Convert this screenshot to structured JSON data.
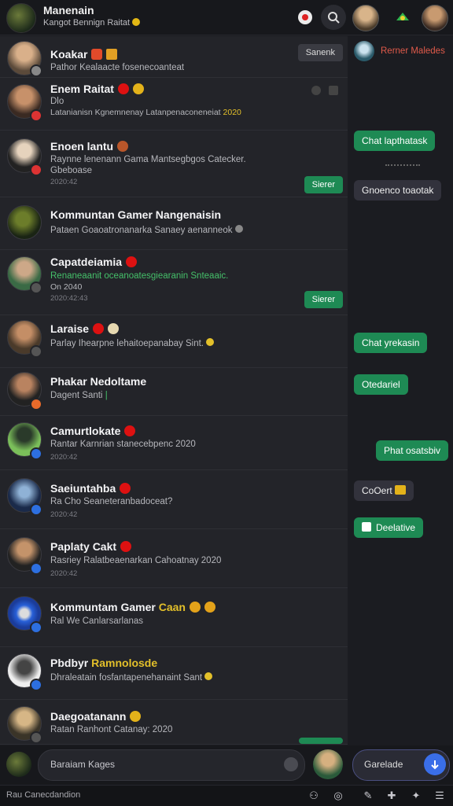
{
  "header": {
    "title": "Manenain",
    "subtitle": "Kangot Bennign Raitat",
    "icons": [
      "notification-icon",
      "search-icon",
      "profile-avatar",
      "game-icon",
      "user-avatar"
    ]
  },
  "chats": [
    {
      "name": "Koakar",
      "message": "Pathor Kealaacte fosenecoanteat",
      "meta": "",
      "action": "Sanenk"
    },
    {
      "name": "Enem Raitat",
      "message": "Dlo",
      "message2": "Latanianisn Kgnemnenay Latanpenaconeneiat",
      "meta": "2020",
      "action": ""
    },
    {
      "name": "Enoen lantu",
      "message": "Raynne lenenann Gama Mantsegbgos Catecker.",
      "message2": "Gbeboase",
      "meta": "2020:42",
      "action": "Sierer"
    },
    {
      "name": "Kommuntan Gamer Nangenaisin",
      "message": "Pataen Goaoatronanarka Sanaey aenanneok",
      "meta": "",
      "action": ""
    },
    {
      "name": "Capatdeiamia",
      "message": "Renaneaanit oceanoatesgiearanin Snteaaic.",
      "message2": "On 2040",
      "meta": "2020:42:43",
      "action": "Sierer"
    },
    {
      "name": "Laraise",
      "message": "Parlay Ihearpne lehaitoepanabay Sint.",
      "meta": "",
      "action": ""
    },
    {
      "name": "Phakar Nedoltame",
      "message": "Dagent Santi",
      "meta": "",
      "action": ""
    },
    {
      "name": "Camurtlokate",
      "message": "Rantar Karnrian stanecebpenc 2020",
      "meta": "2020:42",
      "action": ""
    },
    {
      "name": "Saeiuntahba",
      "message": "Ra Cho Seaneteranbadoceat?",
      "meta": "2020:42",
      "action": ""
    },
    {
      "name": "Paplaty Cakt",
      "message": "Rasriey Ralatbeaenarkan Cahoatnay 2020",
      "meta": "2020:42",
      "action": ""
    },
    {
      "name": "Kommuntam Gamer",
      "name_accent": "Caan",
      "message": "Ral We Canlarsarlanas",
      "meta": "",
      "action": ""
    },
    {
      "name": "Pbdbyr",
      "name_accent": "Ramnolosde",
      "message": "Dhraleatain fosfantapenehanaint Sant",
      "meta": "",
      "action": ""
    },
    {
      "name": "Daegoatanann",
      "message": "Ratan Ranhont Catanay: 2020",
      "meta": "",
      "action": ""
    }
  ],
  "right_panel": {
    "header": "Rerner Maledes",
    "bubbles": [
      "Chat lapthatask",
      "Gnoenco toaotak",
      "Chat yrekasin",
      "Otedariel",
      "Phat osatsbiv",
      "CoOert",
      "Deelative"
    ]
  },
  "composer": {
    "placeholder": "Baraiam Kages",
    "right_input": "Garelade"
  },
  "footer": {
    "label": "Rau Canecdandion"
  },
  "colors": {
    "background": "#1b1c21",
    "accent_green": "#1e8a54",
    "link_blue": "#3d8bf0"
  }
}
